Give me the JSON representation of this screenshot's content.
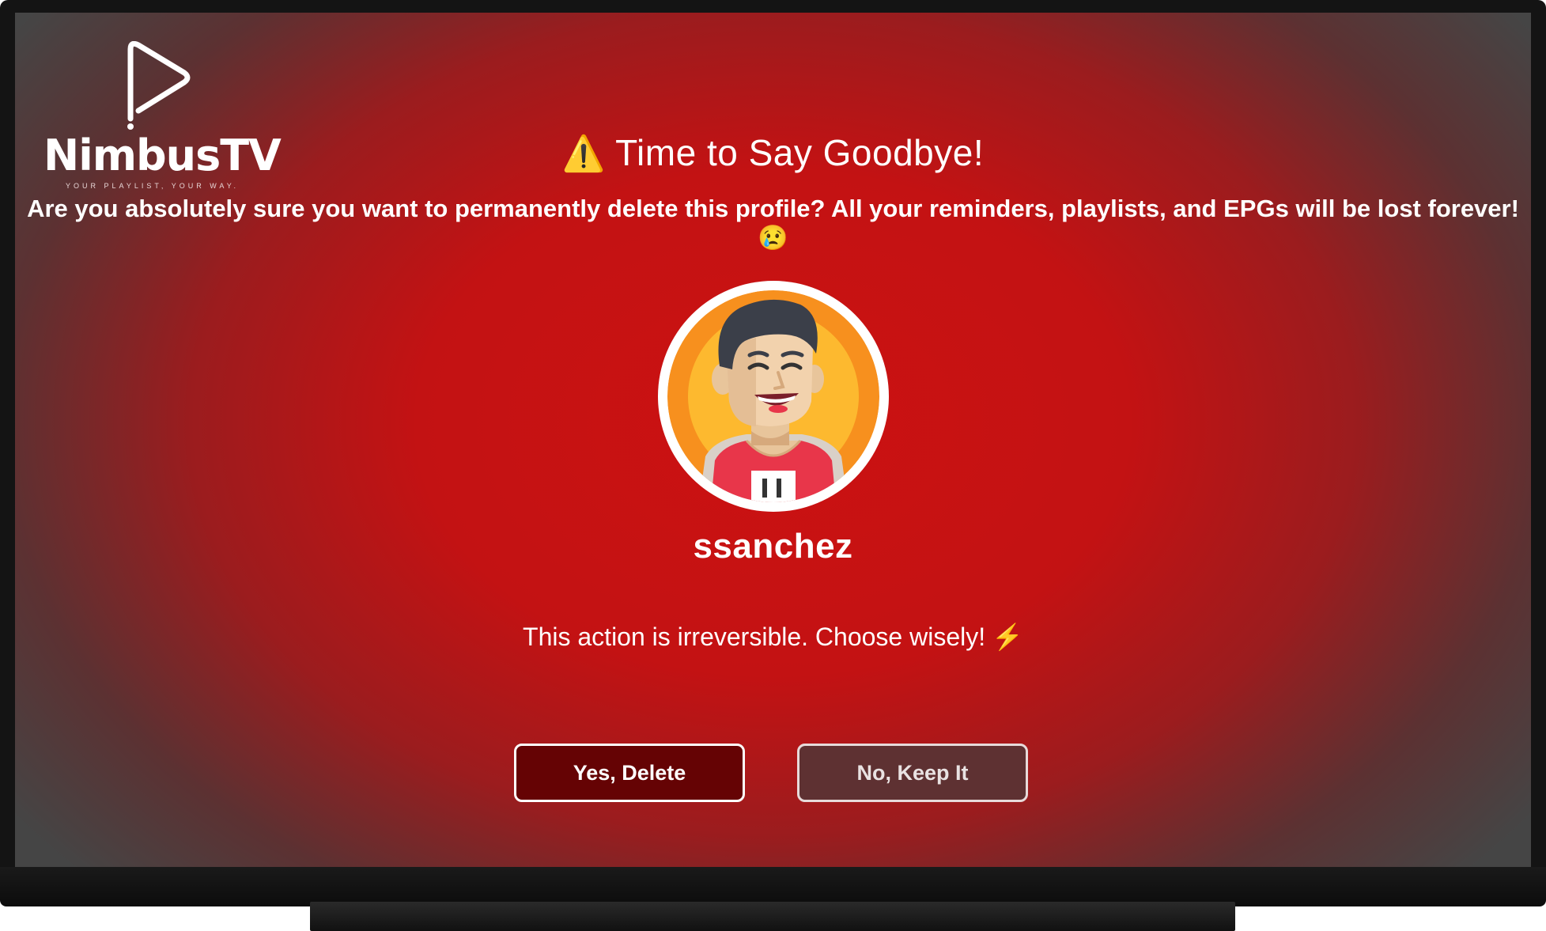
{
  "app": {
    "name": "NimbusTV",
    "tagline": "YOUR PLAYLIST, YOUR WAY."
  },
  "dialog": {
    "warning_icon": "⚠️",
    "title": "Time to Say Goodbye!",
    "message": "Are you absolutely sure you want to permanently delete this profile? All your reminders, playlists, and EPGs will be lost forever! 😢",
    "username": "ssanchez",
    "note": "This action is irreversible. Choose wisely!",
    "note_icon": "⚡",
    "confirm_label": "Yes, Delete",
    "cancel_label": "No, Keep It"
  },
  "colors": {
    "background_center": "#cc1112",
    "background_edge": "#454545",
    "confirm_button": "#650304",
    "cancel_button": "#5e3132",
    "avatar_orange": "#f7901e"
  },
  "icons": {
    "logo": "play-triangle-icon",
    "avatar": "smiling-man-avatar"
  }
}
